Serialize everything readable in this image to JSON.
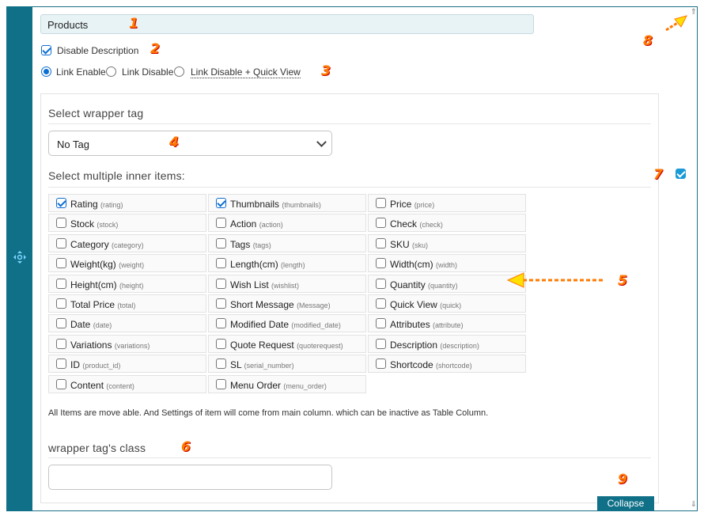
{
  "title_field": {
    "value": "Products"
  },
  "disable_description": {
    "label": "Disable Description",
    "checked": true
  },
  "link_options": [
    {
      "label": "Link Enable",
      "selected": true
    },
    {
      "label": "Link Disable",
      "selected": false
    },
    {
      "label": "Link Disable + Quick View",
      "selected": false
    }
  ],
  "wrapper_tag": {
    "title": "Select wrapper tag",
    "selected": "No Tag"
  },
  "inner_items": {
    "title": "Select multiple inner items:",
    "items": [
      {
        "label": "Rating",
        "key": "(rating)",
        "checked": true
      },
      {
        "label": "Thumbnails",
        "key": "(thumbnails)",
        "checked": true
      },
      {
        "label": "Price",
        "key": "(price)",
        "checked": false
      },
      {
        "label": "Stock",
        "key": "(stock)",
        "checked": false
      },
      {
        "label": "Action",
        "key": "(action)",
        "checked": false
      },
      {
        "label": "Check",
        "key": "(check)",
        "checked": false
      },
      {
        "label": "Category",
        "key": "(category)",
        "checked": false
      },
      {
        "label": "Tags",
        "key": "(tags)",
        "checked": false
      },
      {
        "label": "SKU",
        "key": "(sku)",
        "checked": false
      },
      {
        "label": "Weight(kg)",
        "key": "(weight)",
        "checked": false
      },
      {
        "label": "Length(cm)",
        "key": "(length)",
        "checked": false
      },
      {
        "label": "Width(cm)",
        "key": "(width)",
        "checked": false
      },
      {
        "label": "Height(cm)",
        "key": "(height)",
        "checked": false
      },
      {
        "label": "Wish List",
        "key": "(wishlist)",
        "checked": false
      },
      {
        "label": "Quantity",
        "key": "(quantity)",
        "checked": false
      },
      {
        "label": "Total Price",
        "key": "(total)",
        "checked": false
      },
      {
        "label": "Short Message",
        "key": "(Message)",
        "checked": false
      },
      {
        "label": "Quick View",
        "key": "(quick)",
        "checked": false
      },
      {
        "label": "Date",
        "key": "(date)",
        "checked": false
      },
      {
        "label": "Modified Date",
        "key": "(modified_date)",
        "checked": false
      },
      {
        "label": "Attributes",
        "key": "(attribute)",
        "checked": false
      },
      {
        "label": "Variations",
        "key": "(variations)",
        "checked": false
      },
      {
        "label": "Quote Request",
        "key": "(quoterequest)",
        "checked": false
      },
      {
        "label": "Description",
        "key": "(description)",
        "checked": false
      },
      {
        "label": "ID",
        "key": "(product_id)",
        "checked": false
      },
      {
        "label": "SL",
        "key": "(serial_number)",
        "checked": false
      },
      {
        "label": "Shortcode",
        "key": "(shortcode)",
        "checked": false
      },
      {
        "label": "Content",
        "key": "(content)",
        "checked": false
      },
      {
        "label": "Menu Order",
        "key": "(menu_order)",
        "checked": false
      }
    ]
  },
  "note": "All Items are move able. And Settings of item will come from main column. which can be inactive as Table Column.",
  "wrapper_class": {
    "title": "wrapper tag's class",
    "value": ""
  },
  "column_toggle": {
    "checked": true
  },
  "collapse_button": "Collapse",
  "annotations": [
    "1",
    "2",
    "3",
    "4",
    "5",
    "6",
    "7",
    "8",
    "9"
  ],
  "colors": {
    "sidebar": "#0f7088",
    "annotation": "#ff7a00",
    "accent": "#0d6ed1"
  },
  "icons": {
    "move": "move-arrows-icon",
    "scroll_up": "arrow-up-icon",
    "scroll_down": "arrow-down-icon",
    "dropdown": "chevron-down-icon"
  }
}
